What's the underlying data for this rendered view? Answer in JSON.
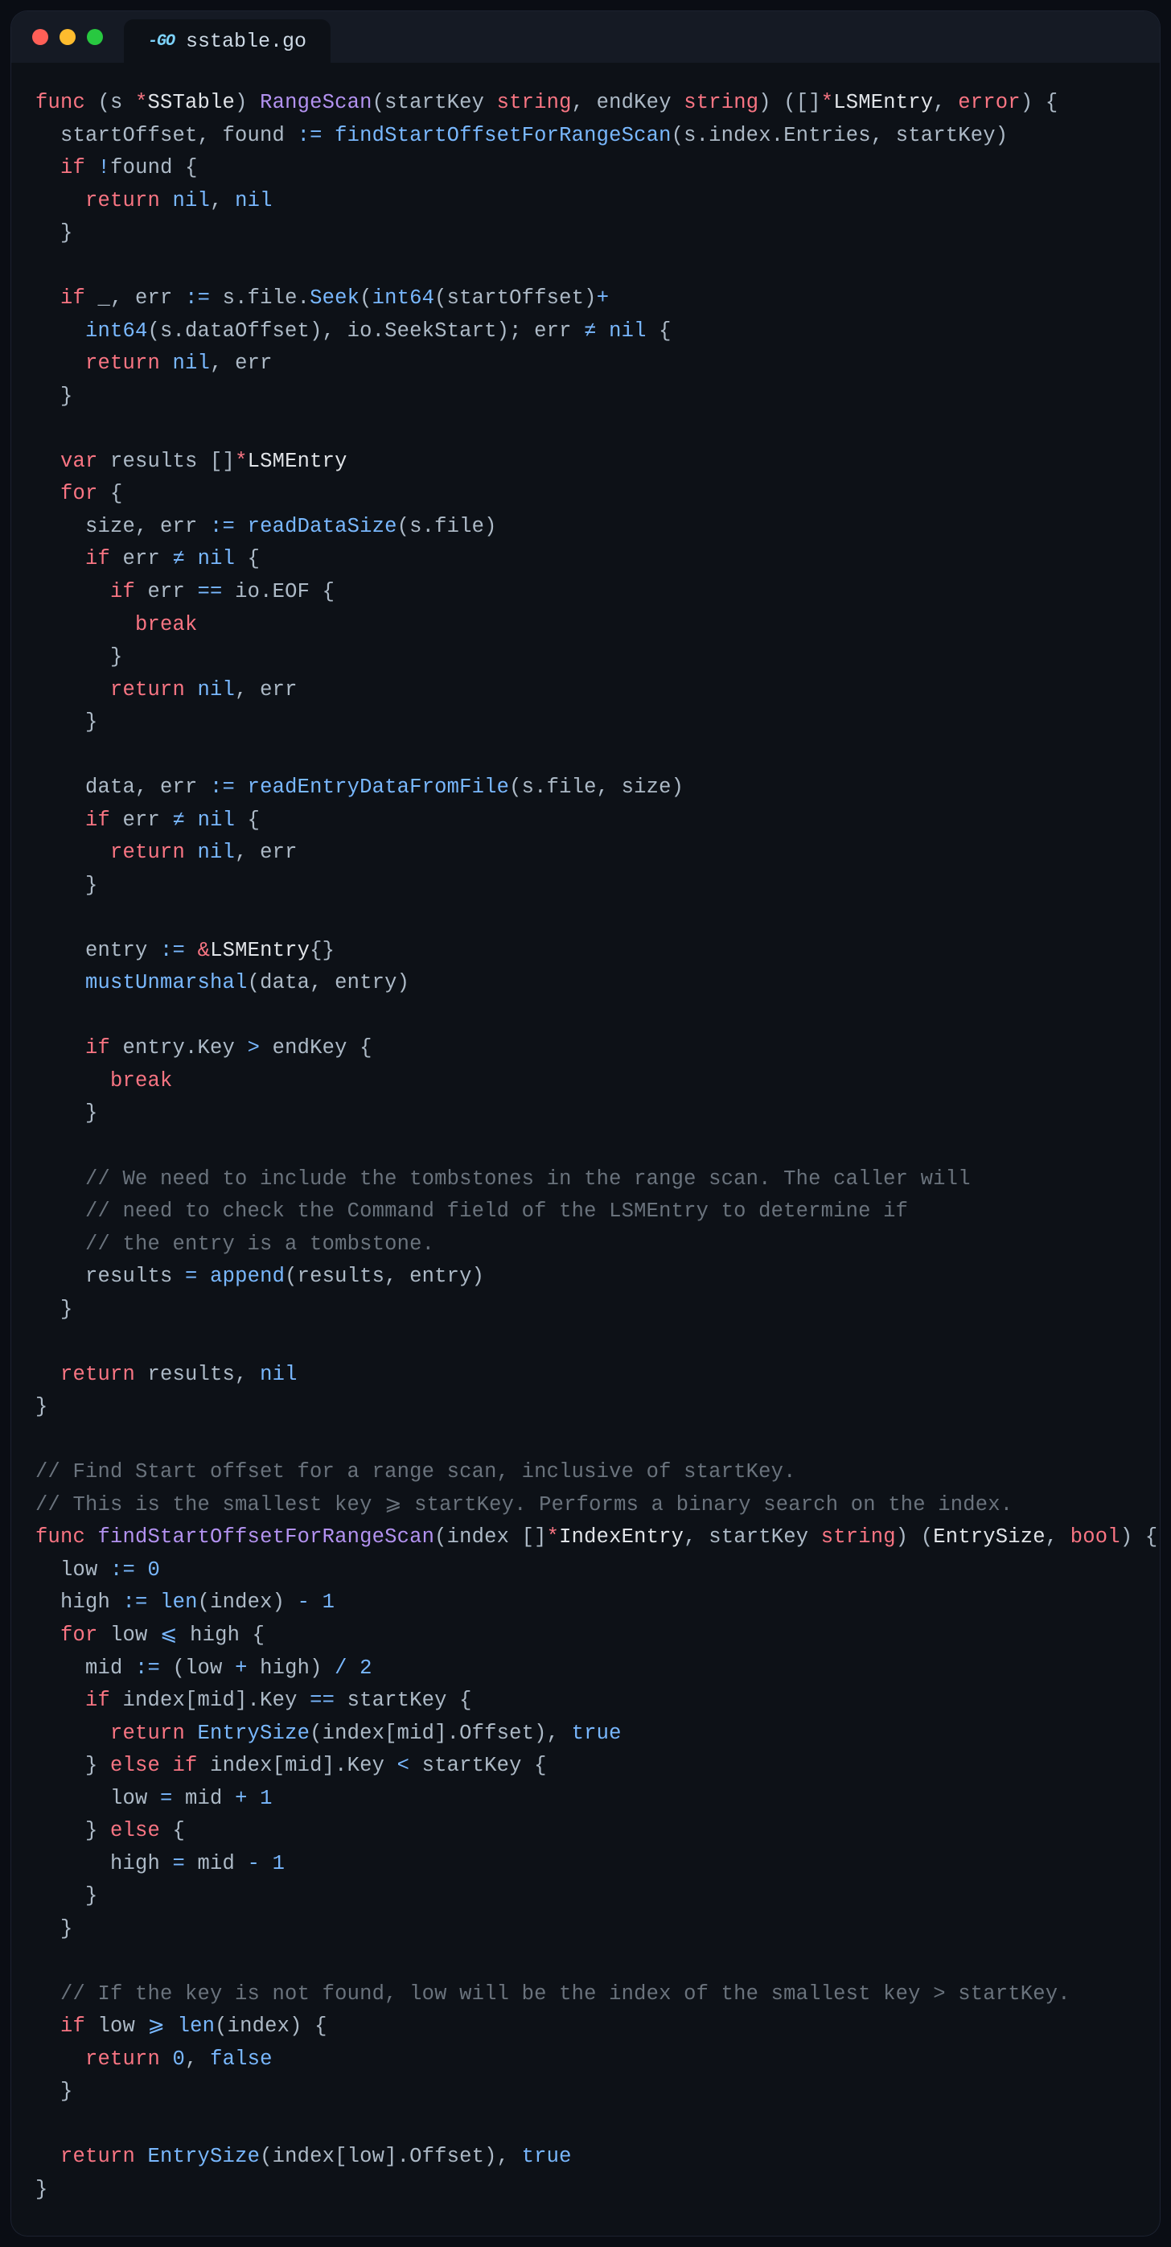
{
  "tab": {
    "filename": "sstable.go",
    "icon": "go-icon"
  },
  "window_controls": [
    "close",
    "minimize",
    "zoom"
  ],
  "code_tokens": [
    [
      [
        "kw",
        "func"
      ],
      [
        "g",
        " (s "
      ],
      [
        "st",
        "*"
      ],
      [
        "id",
        "SSTable"
      ],
      [
        "g",
        ") "
      ],
      [
        "fnDecl",
        "RangeScan"
      ],
      [
        "g",
        "(startKey "
      ],
      [
        "ty",
        "string"
      ],
      [
        "g",
        ", endKey "
      ],
      [
        "ty",
        "string"
      ],
      [
        "g",
        ") ([]"
      ],
      [
        "st",
        "*"
      ],
      [
        "id",
        "LSMEntry"
      ],
      [
        "g",
        ", "
      ],
      [
        "ty",
        "error"
      ],
      [
        "g",
        ") {"
      ]
    ],
    [
      [
        "g",
        "  startOffset, found "
      ],
      [
        "op",
        ":="
      ],
      [
        "g",
        " "
      ],
      [
        "fn",
        "findStartOffsetForRangeScan"
      ],
      [
        "g",
        "(s.index.Entries, startKey)"
      ]
    ],
    [
      [
        "g",
        "  "
      ],
      [
        "kw",
        "if"
      ],
      [
        "g",
        " "
      ],
      [
        "op",
        "!"
      ],
      [
        "g",
        "found {"
      ]
    ],
    [
      [
        "g",
        "    "
      ],
      [
        "kw",
        "return"
      ],
      [
        "g",
        " "
      ],
      [
        "bl",
        "nil"
      ],
      [
        "g",
        ", "
      ],
      [
        "bl",
        "nil"
      ]
    ],
    [
      [
        "g",
        "  }"
      ]
    ],
    [
      [
        "g",
        ""
      ]
    ],
    [
      [
        "g",
        "  "
      ],
      [
        "kw",
        "if"
      ],
      [
        "g",
        " _, err "
      ],
      [
        "op",
        ":="
      ],
      [
        "g",
        " s.file."
      ],
      [
        "fn",
        "Seek"
      ],
      [
        "g",
        "("
      ],
      [
        "fn",
        "int64"
      ],
      [
        "g",
        "(startOffset)"
      ],
      [
        "op",
        "+"
      ]
    ],
    [
      [
        "g",
        "    "
      ],
      [
        "fn",
        "int64"
      ],
      [
        "g",
        "(s.dataOffset), io.SeekStart); err "
      ],
      [
        "op",
        "≠"
      ],
      [
        "g",
        " "
      ],
      [
        "bl",
        "nil"
      ],
      [
        "g",
        " {"
      ]
    ],
    [
      [
        "g",
        "    "
      ],
      [
        "kw",
        "return"
      ],
      [
        "g",
        " "
      ],
      [
        "bl",
        "nil"
      ],
      [
        "g",
        ", err"
      ]
    ],
    [
      [
        "g",
        "  }"
      ]
    ],
    [
      [
        "g",
        ""
      ]
    ],
    [
      [
        "g",
        "  "
      ],
      [
        "kw",
        "var"
      ],
      [
        "g",
        " results []"
      ],
      [
        "st",
        "*"
      ],
      [
        "id",
        "LSMEntry"
      ]
    ],
    [
      [
        "g",
        "  "
      ],
      [
        "kw",
        "for"
      ],
      [
        "g",
        " {"
      ]
    ],
    [
      [
        "g",
        "    size, err "
      ],
      [
        "op",
        ":="
      ],
      [
        "g",
        " "
      ],
      [
        "fn",
        "readDataSize"
      ],
      [
        "g",
        "(s.file)"
      ]
    ],
    [
      [
        "g",
        "    "
      ],
      [
        "kw",
        "if"
      ],
      [
        "g",
        " err "
      ],
      [
        "op",
        "≠"
      ],
      [
        "g",
        " "
      ],
      [
        "bl",
        "nil"
      ],
      [
        "g",
        " {"
      ]
    ],
    [
      [
        "g",
        "      "
      ],
      [
        "kw",
        "if"
      ],
      [
        "g",
        " err "
      ],
      [
        "op",
        "=="
      ],
      [
        "g",
        " io.EOF {"
      ]
    ],
    [
      [
        "g",
        "        "
      ],
      [
        "kw",
        "break"
      ]
    ],
    [
      [
        "g",
        "      }"
      ]
    ],
    [
      [
        "g",
        "      "
      ],
      [
        "kw",
        "return"
      ],
      [
        "g",
        " "
      ],
      [
        "bl",
        "nil"
      ],
      [
        "g",
        ", err"
      ]
    ],
    [
      [
        "g",
        "    }"
      ]
    ],
    [
      [
        "g",
        ""
      ]
    ],
    [
      [
        "g",
        "    data, err "
      ],
      [
        "op",
        ":="
      ],
      [
        "g",
        " "
      ],
      [
        "fn",
        "readEntryDataFromFile"
      ],
      [
        "g",
        "(s.file, size)"
      ]
    ],
    [
      [
        "g",
        "    "
      ],
      [
        "kw",
        "if"
      ],
      [
        "g",
        " err "
      ],
      [
        "op",
        "≠"
      ],
      [
        "g",
        " "
      ],
      [
        "bl",
        "nil"
      ],
      [
        "g",
        " {"
      ]
    ],
    [
      [
        "g",
        "      "
      ],
      [
        "kw",
        "return"
      ],
      [
        "g",
        " "
      ],
      [
        "bl",
        "nil"
      ],
      [
        "g",
        ", err"
      ]
    ],
    [
      [
        "g",
        "    }"
      ]
    ],
    [
      [
        "g",
        ""
      ]
    ],
    [
      [
        "g",
        "    entry "
      ],
      [
        "op",
        ":="
      ],
      [
        "g",
        " "
      ],
      [
        "st",
        "&"
      ],
      [
        "id",
        "LSMEntry"
      ],
      [
        "g",
        "{}"
      ]
    ],
    [
      [
        "g",
        "    "
      ],
      [
        "fn",
        "mustUnmarshal"
      ],
      [
        "g",
        "(data, entry)"
      ]
    ],
    [
      [
        "g",
        ""
      ]
    ],
    [
      [
        "g",
        "    "
      ],
      [
        "kw",
        "if"
      ],
      [
        "g",
        " entry.Key "
      ],
      [
        "op",
        ">"
      ],
      [
        "g",
        " endKey {"
      ]
    ],
    [
      [
        "g",
        "      "
      ],
      [
        "kw",
        "break"
      ]
    ],
    [
      [
        "g",
        "    }"
      ]
    ],
    [
      [
        "g",
        ""
      ]
    ],
    [
      [
        "g",
        "    "
      ],
      [
        "cm",
        "// We need to include the tombstones in the range scan. The caller will"
      ]
    ],
    [
      [
        "g",
        "    "
      ],
      [
        "cm",
        "// need to check the Command field of the LSMEntry to determine if"
      ]
    ],
    [
      [
        "g",
        "    "
      ],
      [
        "cm",
        "// the entry is a tombstone."
      ]
    ],
    [
      [
        "g",
        "    results "
      ],
      [
        "op",
        "="
      ],
      [
        "g",
        " "
      ],
      [
        "fn",
        "append"
      ],
      [
        "g",
        "(results, entry)"
      ]
    ],
    [
      [
        "g",
        "  }"
      ]
    ],
    [
      [
        "g",
        ""
      ]
    ],
    [
      [
        "g",
        "  "
      ],
      [
        "kw",
        "return"
      ],
      [
        "g",
        " results, "
      ],
      [
        "bl",
        "nil"
      ]
    ],
    [
      [
        "g",
        "}"
      ]
    ],
    [
      [
        "g",
        ""
      ]
    ],
    [
      [
        "cm",
        "// Find Start offset for a range scan, inclusive of startKey."
      ]
    ],
    [
      [
        "cm",
        "// This is the smallest key ⩾ startKey. Performs a binary search on the index."
      ]
    ],
    [
      [
        "kw",
        "func"
      ],
      [
        "g",
        " "
      ],
      [
        "fnDecl",
        "findStartOffsetForRangeScan"
      ],
      [
        "g",
        "(index []"
      ],
      [
        "st",
        "*"
      ],
      [
        "id",
        "IndexEntry"
      ],
      [
        "g",
        ", startKey "
      ],
      [
        "ty",
        "string"
      ],
      [
        "g",
        ") ("
      ],
      [
        "id",
        "EntrySize"
      ],
      [
        "g",
        ", "
      ],
      [
        "ty",
        "bool"
      ],
      [
        "g",
        ") {"
      ]
    ],
    [
      [
        "g",
        "  low "
      ],
      [
        "op",
        ":="
      ],
      [
        "g",
        " "
      ],
      [
        "num",
        "0"
      ]
    ],
    [
      [
        "g",
        "  high "
      ],
      [
        "op",
        ":="
      ],
      [
        "g",
        " "
      ],
      [
        "fn",
        "len"
      ],
      [
        "g",
        "(index) "
      ],
      [
        "op",
        "-"
      ],
      [
        "g",
        " "
      ],
      [
        "num",
        "1"
      ]
    ],
    [
      [
        "g",
        "  "
      ],
      [
        "kw",
        "for"
      ],
      [
        "g",
        " low "
      ],
      [
        "op",
        "⩽"
      ],
      [
        "g",
        " high {"
      ]
    ],
    [
      [
        "g",
        "    mid "
      ],
      [
        "op",
        ":="
      ],
      [
        "g",
        " (low "
      ],
      [
        "op",
        "+"
      ],
      [
        "g",
        " high) "
      ],
      [
        "op",
        "/"
      ],
      [
        "g",
        " "
      ],
      [
        "num",
        "2"
      ]
    ],
    [
      [
        "g",
        "    "
      ],
      [
        "kw",
        "if"
      ],
      [
        "g",
        " index[mid].Key "
      ],
      [
        "op",
        "=="
      ],
      [
        "g",
        " startKey {"
      ]
    ],
    [
      [
        "g",
        "      "
      ],
      [
        "kw",
        "return"
      ],
      [
        "g",
        " "
      ],
      [
        "fn",
        "EntrySize"
      ],
      [
        "g",
        "(index[mid].Offset), "
      ],
      [
        "bl",
        "true"
      ]
    ],
    [
      [
        "g",
        "    } "
      ],
      [
        "kw",
        "else"
      ],
      [
        "g",
        " "
      ],
      [
        "kw",
        "if"
      ],
      [
        "g",
        " index[mid].Key "
      ],
      [
        "op",
        "<"
      ],
      [
        "g",
        " startKey {"
      ]
    ],
    [
      [
        "g",
        "      low "
      ],
      [
        "op",
        "="
      ],
      [
        "g",
        " mid "
      ],
      [
        "op",
        "+"
      ],
      [
        "g",
        " "
      ],
      [
        "num",
        "1"
      ]
    ],
    [
      [
        "g",
        "    } "
      ],
      [
        "kw",
        "else"
      ],
      [
        "g",
        " {"
      ]
    ],
    [
      [
        "g",
        "      high "
      ],
      [
        "op",
        "="
      ],
      [
        "g",
        " mid "
      ],
      [
        "op",
        "-"
      ],
      [
        "g",
        " "
      ],
      [
        "num",
        "1"
      ]
    ],
    [
      [
        "g",
        "    }"
      ]
    ],
    [
      [
        "g",
        "  }"
      ]
    ],
    [
      [
        "g",
        ""
      ]
    ],
    [
      [
        "g",
        "  "
      ],
      [
        "cm",
        "// If the key is not found, low will be the index of the smallest key > startKey."
      ]
    ],
    [
      [
        "g",
        "  "
      ],
      [
        "kw",
        "if"
      ],
      [
        "g",
        " low "
      ],
      [
        "op",
        "⩾"
      ],
      [
        "g",
        " "
      ],
      [
        "fn",
        "len"
      ],
      [
        "g",
        "(index) {"
      ]
    ],
    [
      [
        "g",
        "    "
      ],
      [
        "kw",
        "return"
      ],
      [
        "g",
        " "
      ],
      [
        "num",
        "0"
      ],
      [
        "g",
        ", "
      ],
      [
        "bl",
        "false"
      ]
    ],
    [
      [
        "g",
        "  }"
      ]
    ],
    [
      [
        "g",
        ""
      ]
    ],
    [
      [
        "g",
        "  "
      ],
      [
        "kw",
        "return"
      ],
      [
        "g",
        " "
      ],
      [
        "fn",
        "EntrySize"
      ],
      [
        "g",
        "(index[low].Offset), "
      ],
      [
        "bl",
        "true"
      ]
    ],
    [
      [
        "g",
        "}"
      ]
    ]
  ]
}
